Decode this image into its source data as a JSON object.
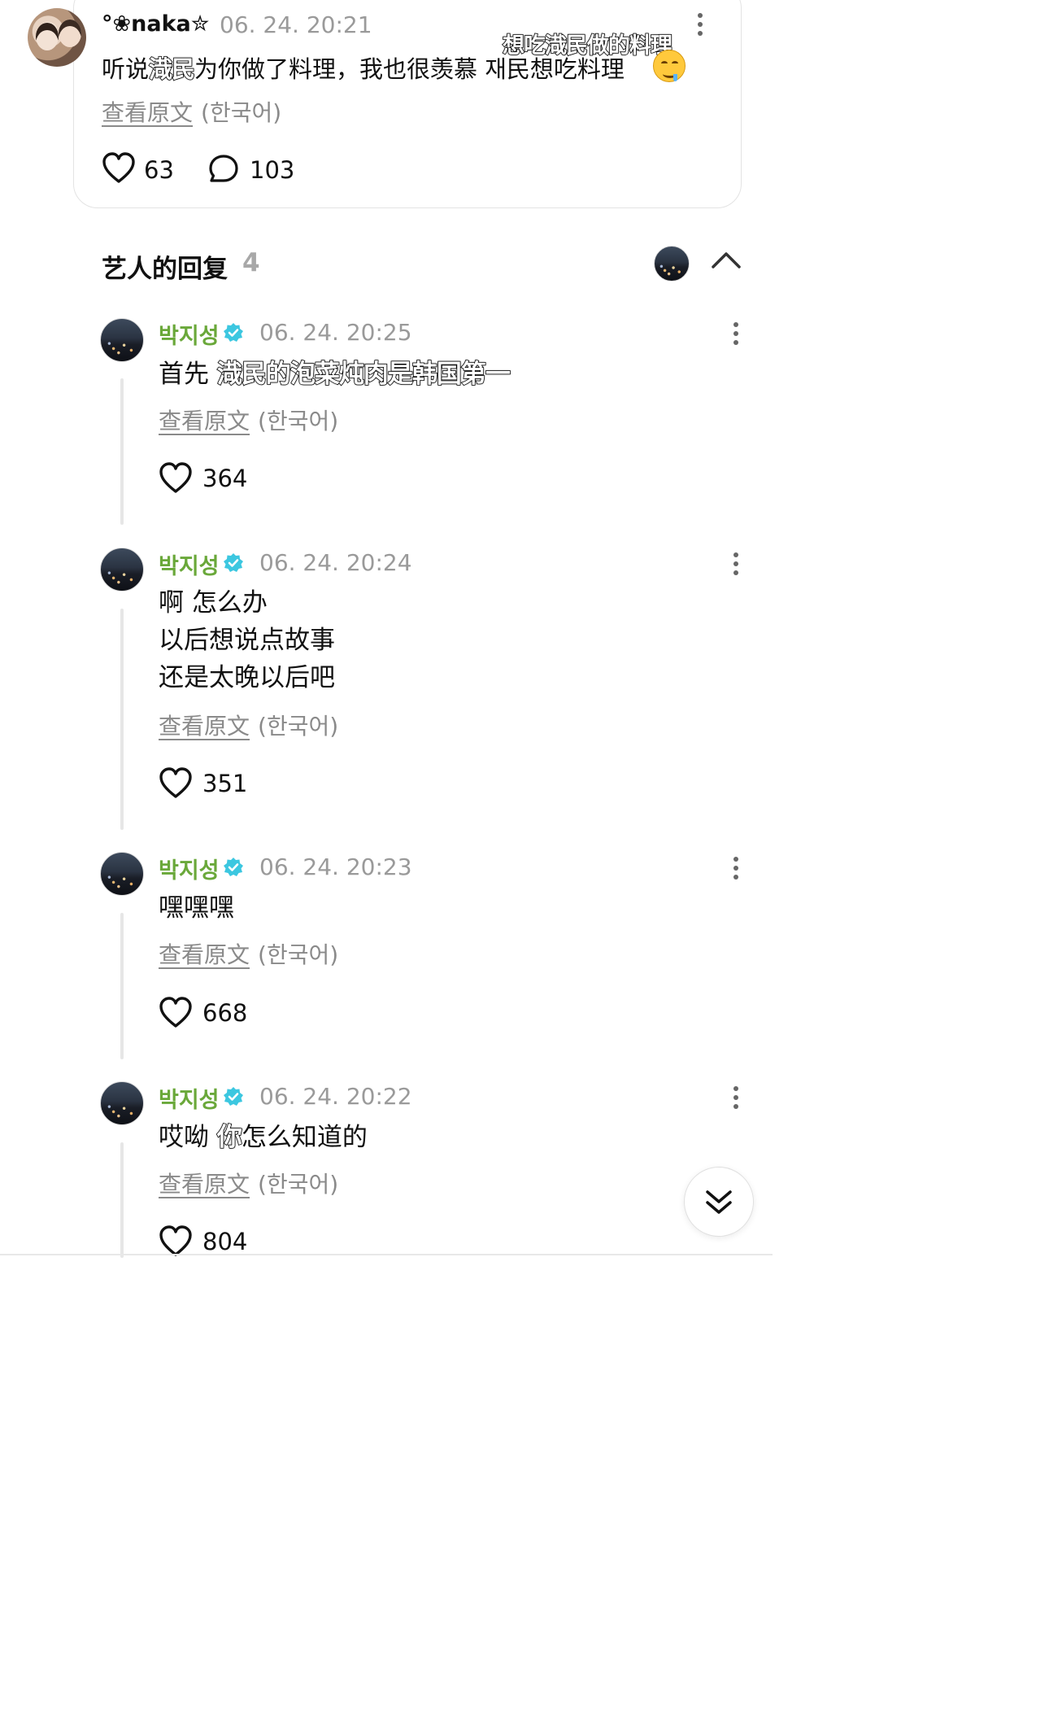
{
  "post": {
    "username": "°❀naka✮",
    "timestamp": "06. 24. 20:21",
    "text_prefix": "听说",
    "text_highlight": "渽民",
    "text_suffix": "为你做了料理，我也很羡慕 재民想吃料理",
    "overlay_caption": "想吃渽民做的料理",
    "translate_link": "查看原文",
    "translate_lang": "(한국어)",
    "like_count": "63",
    "comment_count": "103",
    "emoji": "drooling-face"
  },
  "section": {
    "title": "艺人的回复",
    "count": "4"
  },
  "replies": [
    {
      "name": "박지성",
      "timestamp": "06. 24. 20:25",
      "text_plain": "首先 ",
      "text_caption": "渽民的泡菜炖肉是韩国第一",
      "translate_link": "查看原文",
      "translate_lang": "(한국어)",
      "like_count": "364"
    },
    {
      "name": "박지성",
      "timestamp": "06. 24. 20:24",
      "line1": "啊 怎么办",
      "line2": "以后想说点故事",
      "line3": "还是太晚以后吧",
      "translate_link": "查看原文",
      "translate_lang": "(한국어)",
      "like_count": "351"
    },
    {
      "name": "박지성",
      "timestamp": "06. 24. 20:23",
      "text": "嘿嘿嘿",
      "translate_link": "查看原文",
      "translate_lang": "(한국어)",
      "like_count": "668"
    },
    {
      "name": "박지성",
      "timestamp": "06. 24. 20:22",
      "text_prefix": "哎呦 ",
      "text_caption": "你",
      "text_suffix": "怎么知道的",
      "translate_link": "查看原文",
      "translate_lang": "(한국어)",
      "like_count": "804"
    }
  ],
  "colors": {
    "artist_name": "#6aa83a",
    "verified_badge": "#3cc7e0",
    "muted_text": "#9a9a9a"
  },
  "icons": {
    "like": "heart-icon",
    "comment": "speech-bubble-icon",
    "menu": "more-vertical-icon",
    "collapse": "chevron-up-icon",
    "scroll": "double-chevron-down-icon",
    "verified": "verified-badge-icon"
  }
}
